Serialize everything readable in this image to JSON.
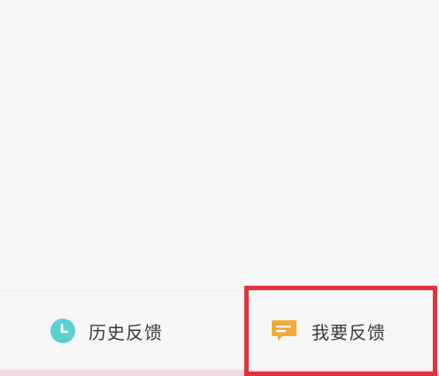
{
  "bottom_bar": {
    "history": {
      "label": "历史反馈",
      "icon": "clock-icon",
      "icon_color": "#5dcfcf"
    },
    "feedback": {
      "label": "我要反馈",
      "icon": "chat-bubble-icon",
      "icon_color": "#f5a93b"
    }
  },
  "highlight": {
    "color": "#e3323a",
    "target": "feedback"
  },
  "colors": {
    "background": "#f8f8f8",
    "bottom_strip": "#f1d9e1",
    "text": "#3a3a3a"
  }
}
